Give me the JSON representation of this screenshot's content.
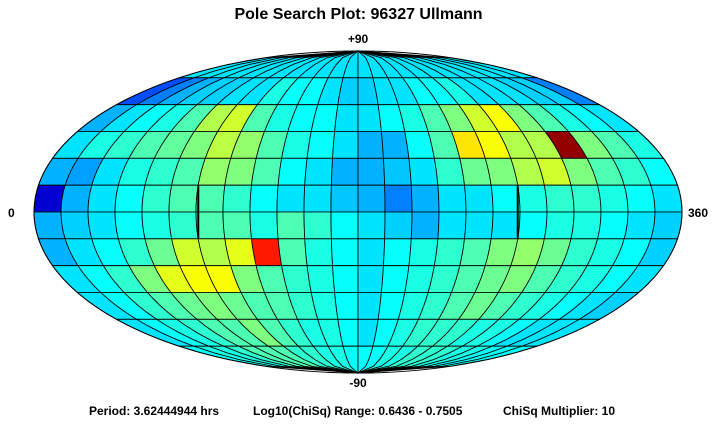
{
  "title": "Pole Search Plot: 96327 Ullmann",
  "labels": {
    "top": "+90",
    "bottom": "-90",
    "left": "0",
    "right": "360"
  },
  "footer": {
    "period": "Period: 3.62444944 hrs",
    "range": "Log10(ChiSq) Range: 0.6436 - 0.7505",
    "multiplier": "ChiSq Multiplier: 10"
  },
  "chart_data": {
    "type": "heatmap",
    "projection": "mollweide",
    "title": "Pole Search Plot: 96327 Ullmann",
    "x_range": [
      0,
      360
    ],
    "y_range": [
      -90,
      90
    ],
    "lon_step": 15,
    "lat_bands": [
      90,
      75,
      60,
      45,
      30,
      15,
      0,
      -15,
      -30,
      -45,
      -60,
      -75,
      -90
    ],
    "value_range": [
      0.6436,
      0.7505
    ],
    "colormap": [
      "#00007f",
      "#0000ff",
      "#007fff",
      "#00ffff",
      "#7fff7f",
      "#ffff00",
      "#ff7f00",
      "#ff0000",
      "#7f0000"
    ],
    "values": [
      [
        0.35,
        0.35,
        0.35,
        0.35,
        0.35,
        0.35,
        0.35,
        0.35,
        0.35,
        0.35,
        0.35,
        0.35,
        0.35,
        0.35,
        0.35,
        0.35,
        0.35,
        0.35,
        0.35,
        0.35,
        0.35,
        0.35,
        0.35,
        0.35
      ],
      [
        0.2,
        0.25,
        0.3,
        0.33,
        0.33,
        0.35,
        0.35,
        0.4,
        0.38,
        0.38,
        0.35,
        0.33,
        0.33,
        0.35,
        0.35,
        0.38,
        0.38,
        0.4,
        0.35,
        0.35,
        0.35,
        0.33,
        0.33,
        0.25
      ],
      [
        0.3,
        0.35,
        0.38,
        0.4,
        0.45,
        0.55,
        0.58,
        0.45,
        0.4,
        0.38,
        0.38,
        0.35,
        0.35,
        0.38,
        0.4,
        0.45,
        0.5,
        0.58,
        0.62,
        0.5,
        0.45,
        0.4,
        0.38,
        0.35
      ],
      [
        0.35,
        0.4,
        0.42,
        0.45,
        0.47,
        0.5,
        0.56,
        0.52,
        0.45,
        0.4,
        0.38,
        0.35,
        0.3,
        0.3,
        0.38,
        0.45,
        0.65,
        0.62,
        0.55,
        0.55,
        0.98,
        0.5,
        0.45,
        0.4
      ],
      [
        0.3,
        0.28,
        0.35,
        0.4,
        0.42,
        0.45,
        0.52,
        0.5,
        0.45,
        0.38,
        0.35,
        0.3,
        0.3,
        0.32,
        0.35,
        0.42,
        0.48,
        0.5,
        0.55,
        0.58,
        0.5,
        0.45,
        0.42,
        0.38
      ],
      [
        0.08,
        0.3,
        0.35,
        0.38,
        0.42,
        0.45,
        0.45,
        0.42,
        0.38,
        0.35,
        0.35,
        0.32,
        0.3,
        0.25,
        0.3,
        0.35,
        0.35,
        0.38,
        0.4,
        0.42,
        0.42,
        0.4,
        0.38,
        0.35
      ],
      [
        0.3,
        0.33,
        0.35,
        0.38,
        0.4,
        0.42,
        0.45,
        0.45,
        0.4,
        0.45,
        0.42,
        0.38,
        0.35,
        0.33,
        0.3,
        0.35,
        0.35,
        0.35,
        0.38,
        0.4,
        0.4,
        0.38,
        0.35,
        0.33
      ],
      [
        0.3,
        0.35,
        0.38,
        0.42,
        0.48,
        0.58,
        0.55,
        0.6,
        0.85,
        0.45,
        0.4,
        0.38,
        0.35,
        0.38,
        0.4,
        0.42,
        0.45,
        0.5,
        0.52,
        0.48,
        0.42,
        0.4,
        0.38,
        0.33
      ],
      [
        0.35,
        0.38,
        0.42,
        0.5,
        0.6,
        0.62,
        0.62,
        0.5,
        0.45,
        0.42,
        0.4,
        0.38,
        0.35,
        0.38,
        0.4,
        0.42,
        0.45,
        0.48,
        0.5,
        0.45,
        0.42,
        0.4,
        0.38,
        0.35
      ],
      [
        0.35,
        0.38,
        0.42,
        0.45,
        0.48,
        0.5,
        0.48,
        0.45,
        0.45,
        0.42,
        0.4,
        0.38,
        0.35,
        0.38,
        0.4,
        0.42,
        0.45,
        0.48,
        0.45,
        0.42,
        0.4,
        0.38,
        0.35,
        0.33
      ],
      [
        0.35,
        0.38,
        0.4,
        0.42,
        0.45,
        0.45,
        0.5,
        0.45,
        0.42,
        0.4,
        0.4,
        0.38,
        0.35,
        0.38,
        0.4,
        0.42,
        0.42,
        0.42,
        0.4,
        0.4,
        0.38,
        0.35,
        0.35,
        0.35
      ],
      [
        0.38,
        0.4,
        0.4,
        0.42,
        0.45,
        0.45,
        0.45,
        0.42,
        0.42,
        0.4,
        0.4,
        0.38,
        0.38,
        0.38,
        0.4,
        0.4,
        0.42,
        0.42,
        0.42,
        0.4,
        0.4,
        0.38,
        0.38,
        0.38
      ]
    ]
  }
}
